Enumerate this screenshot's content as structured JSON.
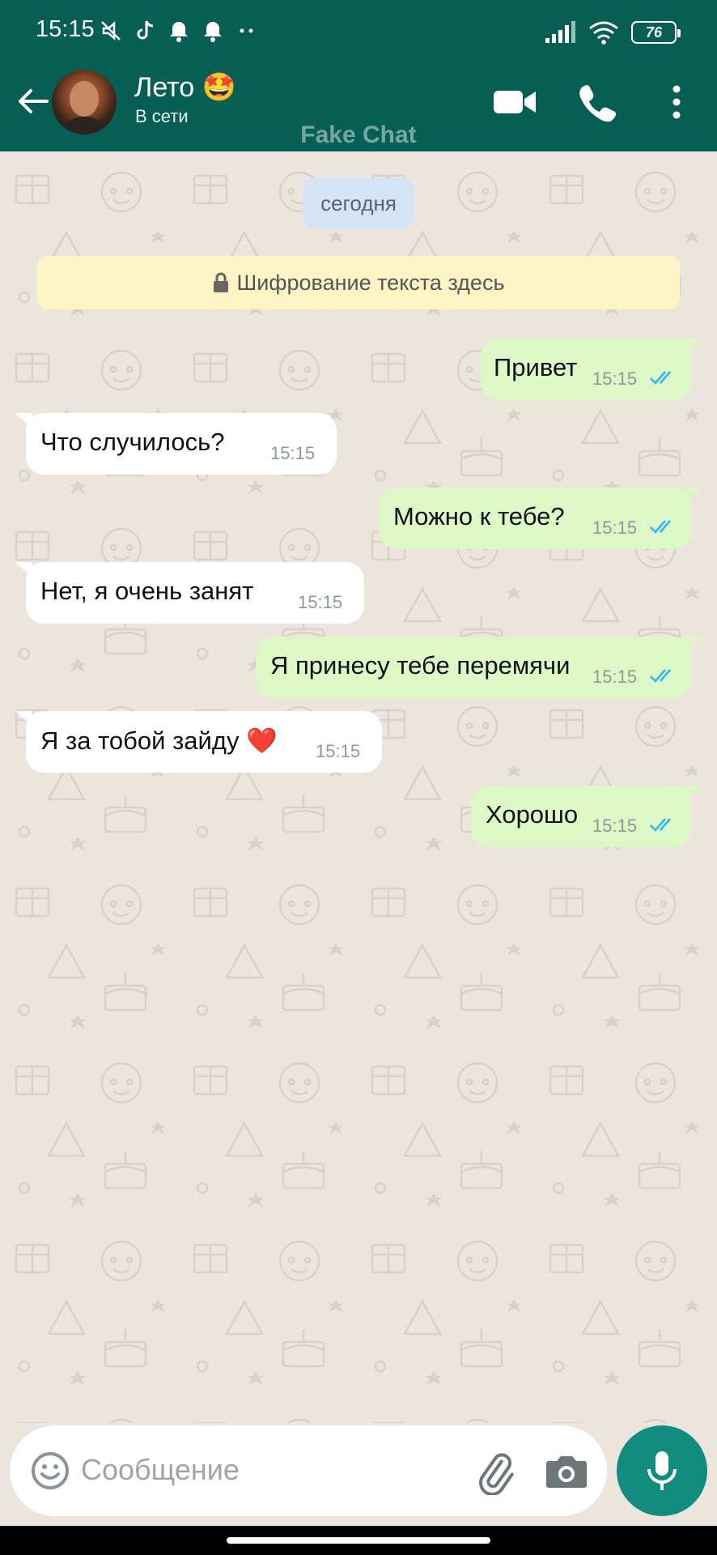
{
  "status_bar": {
    "time": "15:15",
    "battery": "76",
    "icons": [
      "mute-icon",
      "tiktok-icon",
      "bell-icon",
      "bell-icon",
      "more-dots-icon",
      "signal-icon",
      "wifi-icon",
      "battery-icon"
    ]
  },
  "header": {
    "contact_name": "Лето 🤩",
    "contact_status": "В сети",
    "watermark": "Fake Chat",
    "icons": [
      "back-arrow-icon",
      "video-call-icon",
      "phone-icon",
      "overflow-menu-icon"
    ]
  },
  "chat": {
    "date_label": "сегодня",
    "encryption_notice": "Шифрование текста здесь",
    "messages": [
      {
        "direction": "out",
        "text": "Привет",
        "time": "15:15",
        "read": true
      },
      {
        "direction": "in",
        "text": "Что случилось?",
        "time": "15:15"
      },
      {
        "direction": "out",
        "text": "Можно к тебе?",
        "time": "15:15",
        "read": true
      },
      {
        "direction": "in",
        "text": "Нет, я очень занят",
        "time": "15:15"
      },
      {
        "direction": "out",
        "text": "Я принесу тебе перемячи",
        "time": "15:15",
        "read": true
      },
      {
        "direction": "in",
        "text": "Я за тобой зайду ❤️",
        "time": "15:15"
      },
      {
        "direction": "out",
        "text": "Хорошо",
        "time": "15:15",
        "read": true
      }
    ]
  },
  "composer": {
    "placeholder": "Сообщение",
    "icons": [
      "emoji-icon",
      "attach-icon",
      "camera-icon",
      "mic-icon"
    ]
  },
  "colors": {
    "header_bg": "#075e54",
    "outgoing_bubble": "#dcf8c6",
    "incoming_bubble": "#ffffff",
    "mic_button": "#128c7e",
    "read_ticks": "#34b7f1"
  }
}
